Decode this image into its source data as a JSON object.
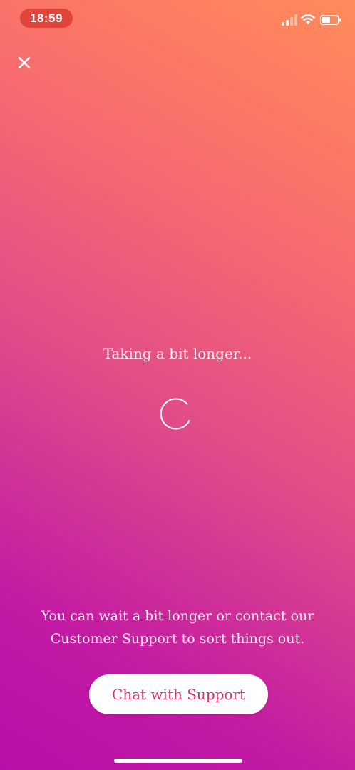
{
  "status_bar": {
    "time": "18:59",
    "time_pill_color": "#e0443a",
    "icons": [
      "signal-icon",
      "wifi-icon",
      "battery-icon"
    ]
  },
  "header": {
    "close_icon": "close-icon"
  },
  "loading": {
    "title": "Taking a bit longer...",
    "spinner_icon": "spinner-icon"
  },
  "footer": {
    "help_text": "You can wait a bit longer or contact our Customer Support to sort things out.",
    "chat_button_label": "Chat with Support",
    "chat_button_color": "#d6336c"
  },
  "colors": {
    "gradient_top_right": "#ff8c5a",
    "gradient_bottom_left": "#b80fa8",
    "text": "#ffffff"
  }
}
